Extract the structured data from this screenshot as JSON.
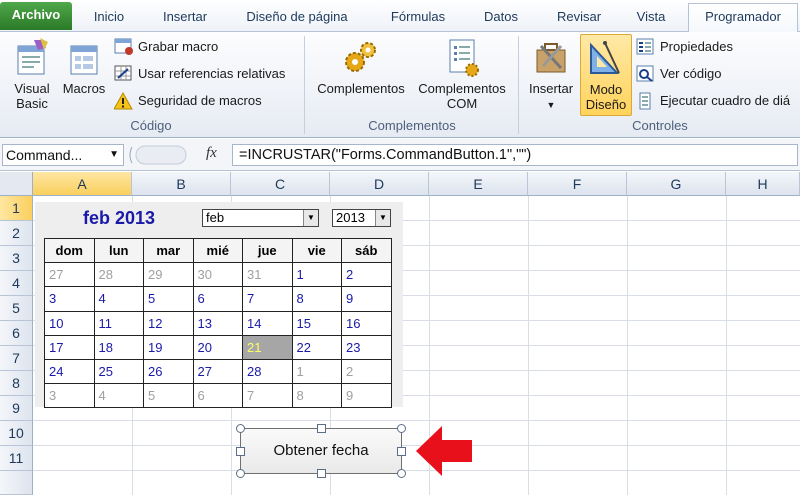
{
  "tabs": {
    "file": "Archivo",
    "inicio": "Inicio",
    "insertar": "Insertar",
    "diseno": "Diseño de página",
    "formulas": "Fórmulas",
    "datos": "Datos",
    "revisar": "Revisar",
    "vista": "Vista",
    "programador": "Programador"
  },
  "ribbon": {
    "codigo": {
      "label": "Código",
      "visual_basic_l1": "Visual",
      "visual_basic_l2": "Basic",
      "macros": "Macros",
      "grabar": "Grabar macro",
      "referencias": "Usar referencias relativas",
      "seguridad": "Seguridad de macros"
    },
    "complementos": {
      "label": "Complementos",
      "complementos": "Complementos",
      "com_l1": "Complementos",
      "com_l2": "COM"
    },
    "controles": {
      "label": "Controles",
      "insertar": "Insertar",
      "modo_l1": "Modo",
      "modo_l2": "Diseño",
      "propiedades": "Propiedades",
      "ver_codigo": "Ver código",
      "ejecutar": "Ejecutar cuadro de diá"
    }
  },
  "formula_bar": {
    "name_box": "Command...",
    "fx": "fx",
    "formula": "=INCRUSTAR(\"Forms.CommandButton.1\",\"\")"
  },
  "grid": {
    "columns": [
      "A",
      "B",
      "C",
      "D",
      "E",
      "F",
      "G",
      "H"
    ],
    "rows": [
      "1",
      "2",
      "3",
      "4",
      "5",
      "6",
      "7",
      "8",
      "9",
      "10",
      "11"
    ]
  },
  "calendar": {
    "title": "feb 2013",
    "month_value": "feb",
    "year_value": "2013",
    "weekdays": [
      "dom",
      "lun",
      "mar",
      "mié",
      "jue",
      "vie",
      "sáb"
    ],
    "weeks": [
      [
        [
          "27",
          "oth"
        ],
        [
          "28",
          "oth"
        ],
        [
          "29",
          "oth"
        ],
        [
          "30",
          "oth"
        ],
        [
          "31",
          "oth"
        ],
        [
          "1",
          "cur"
        ],
        [
          "2",
          "cur"
        ]
      ],
      [
        [
          "3",
          "cur"
        ],
        [
          "4",
          "cur"
        ],
        [
          "5",
          "cur"
        ],
        [
          "6",
          "cur"
        ],
        [
          "7",
          "cur"
        ],
        [
          "8",
          "cur"
        ],
        [
          "9",
          "cur"
        ]
      ],
      [
        [
          "10",
          "cur"
        ],
        [
          "11",
          "cur"
        ],
        [
          "12",
          "cur"
        ],
        [
          "13",
          "cur"
        ],
        [
          "14",
          "cur"
        ],
        [
          "15",
          "cur"
        ],
        [
          "16",
          "cur"
        ]
      ],
      [
        [
          "17",
          "cur"
        ],
        [
          "18",
          "cur"
        ],
        [
          "19",
          "cur"
        ],
        [
          "20",
          "cur"
        ],
        [
          "21",
          "today"
        ],
        [
          "22",
          "cur"
        ],
        [
          "23",
          "cur"
        ]
      ],
      [
        [
          "24",
          "cur"
        ],
        [
          "25",
          "cur"
        ],
        [
          "26",
          "cur"
        ],
        [
          "27",
          "cur"
        ],
        [
          "28",
          "cur"
        ],
        [
          "1",
          "oth"
        ],
        [
          "2",
          "oth"
        ]
      ],
      [
        [
          "3",
          "oth"
        ],
        [
          "4",
          "oth"
        ],
        [
          "5",
          "oth"
        ],
        [
          "6",
          "oth"
        ],
        [
          "7",
          "oth"
        ],
        [
          "8",
          "oth"
        ],
        [
          "9",
          "oth"
        ]
      ]
    ]
  },
  "command_button": {
    "label": "Obtener fecha"
  },
  "colors": {
    "file_tab": "#2b7a27",
    "calendar_text": "#1a1aa8",
    "today_bg": "#a6a6a6",
    "today_text": "#ffff66",
    "pointer_arrow": "#e8101a",
    "selected_header": "#f9cf5e"
  }
}
